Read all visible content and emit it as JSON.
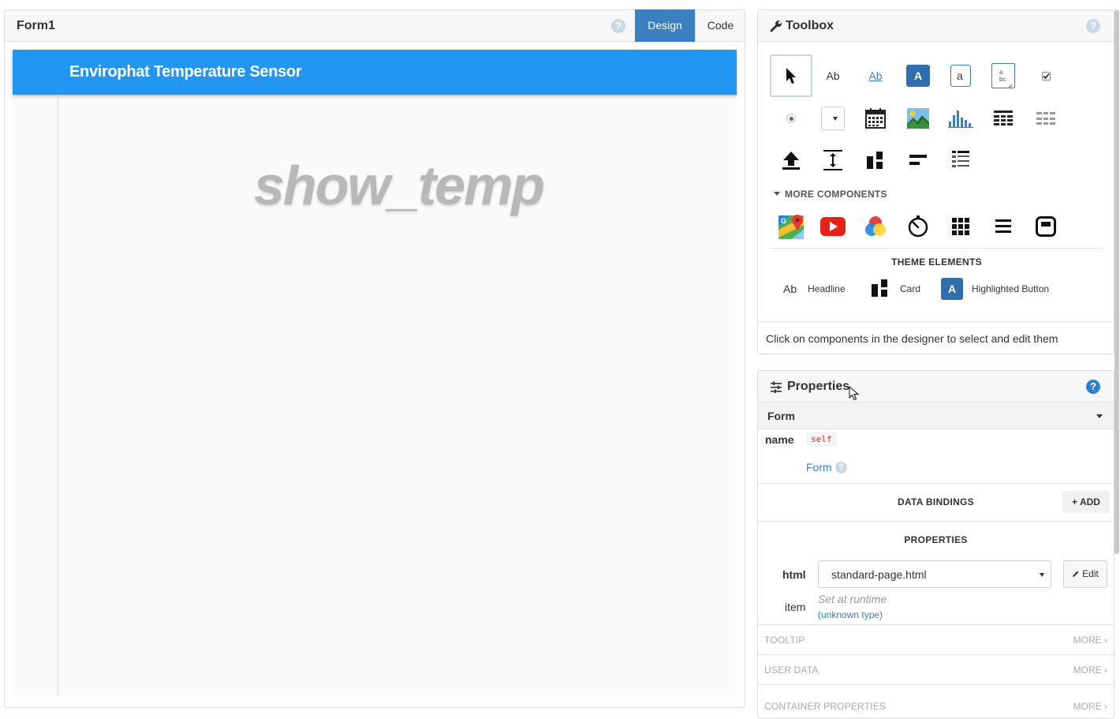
{
  "designer": {
    "title": "Form1",
    "help_glyph": "?",
    "tabs": {
      "design": "Design",
      "code": "Code"
    },
    "app_title": "Envirophat Temperature Sensor",
    "placeholder": "show_temp"
  },
  "toolbox": {
    "title": "Toolbox",
    "help_glyph": "?",
    "tools_row1": [
      "pointer-icon",
      "label-icon",
      "link-icon",
      "button-icon",
      "textbox-icon",
      "textarea-icon",
      "checkbox-icon"
    ],
    "tools_row2": [
      "radiobutton-icon",
      "dropdown-icon",
      "datepicker-icon",
      "image-icon",
      "plot-icon",
      "repeating-panel-icon",
      "data-grid-icon"
    ],
    "tools_row3": [
      "fileloader-icon",
      "spacer-icon",
      "column-panel-icon",
      "linear-panel-icon",
      "flow-panel-icon"
    ],
    "tool_glyphs": {
      "label": "Ab",
      "link": "Ab",
      "button": "A",
      "textbox": "a",
      "textarea_a": "a",
      "textarea_b": "bc"
    },
    "more_components_label": "MORE COMPONENTS",
    "more_components": [
      "google-map-icon",
      "youtube-icon",
      "canvas-icon",
      "timer-icon",
      "grid-panel-icon",
      "xy-panel-icon",
      "html-panel-icon"
    ],
    "theme_elements_label": "THEME ELEMENTS",
    "theme_elements": [
      {
        "label": "Headline",
        "glyph": "Ab"
      },
      {
        "label": "Card"
      },
      {
        "label": "Highlighted Button",
        "glyph": "A"
      }
    ],
    "footer_hint": "Click on components in the designer to select and edit them"
  },
  "properties": {
    "title": "Properties",
    "help_glyph": "?",
    "component_select": "Form",
    "name_label": "name",
    "name_value": "self",
    "form_link": "Form",
    "data_bindings_label": "DATA BINDINGS",
    "add_label": "+ ADD",
    "properties_label": "PROPERTIES",
    "html_label": "html",
    "html_value": "standard-page.html",
    "edit_label": "Edit",
    "item_label": "item",
    "item_runtime": "Set at runtime",
    "item_type": "(unknown type)",
    "sections": [
      {
        "title": "TOOLTIP",
        "more": "MORE"
      },
      {
        "title": "USER DATA",
        "more": "MORE"
      },
      {
        "title": "CONTAINER PROPERTIES",
        "more": "MORE"
      }
    ]
  },
  "colors": {
    "accent": "#3a7fc0",
    "app_bar": "#2196f3",
    "placeholder": "#b8b8b8"
  }
}
